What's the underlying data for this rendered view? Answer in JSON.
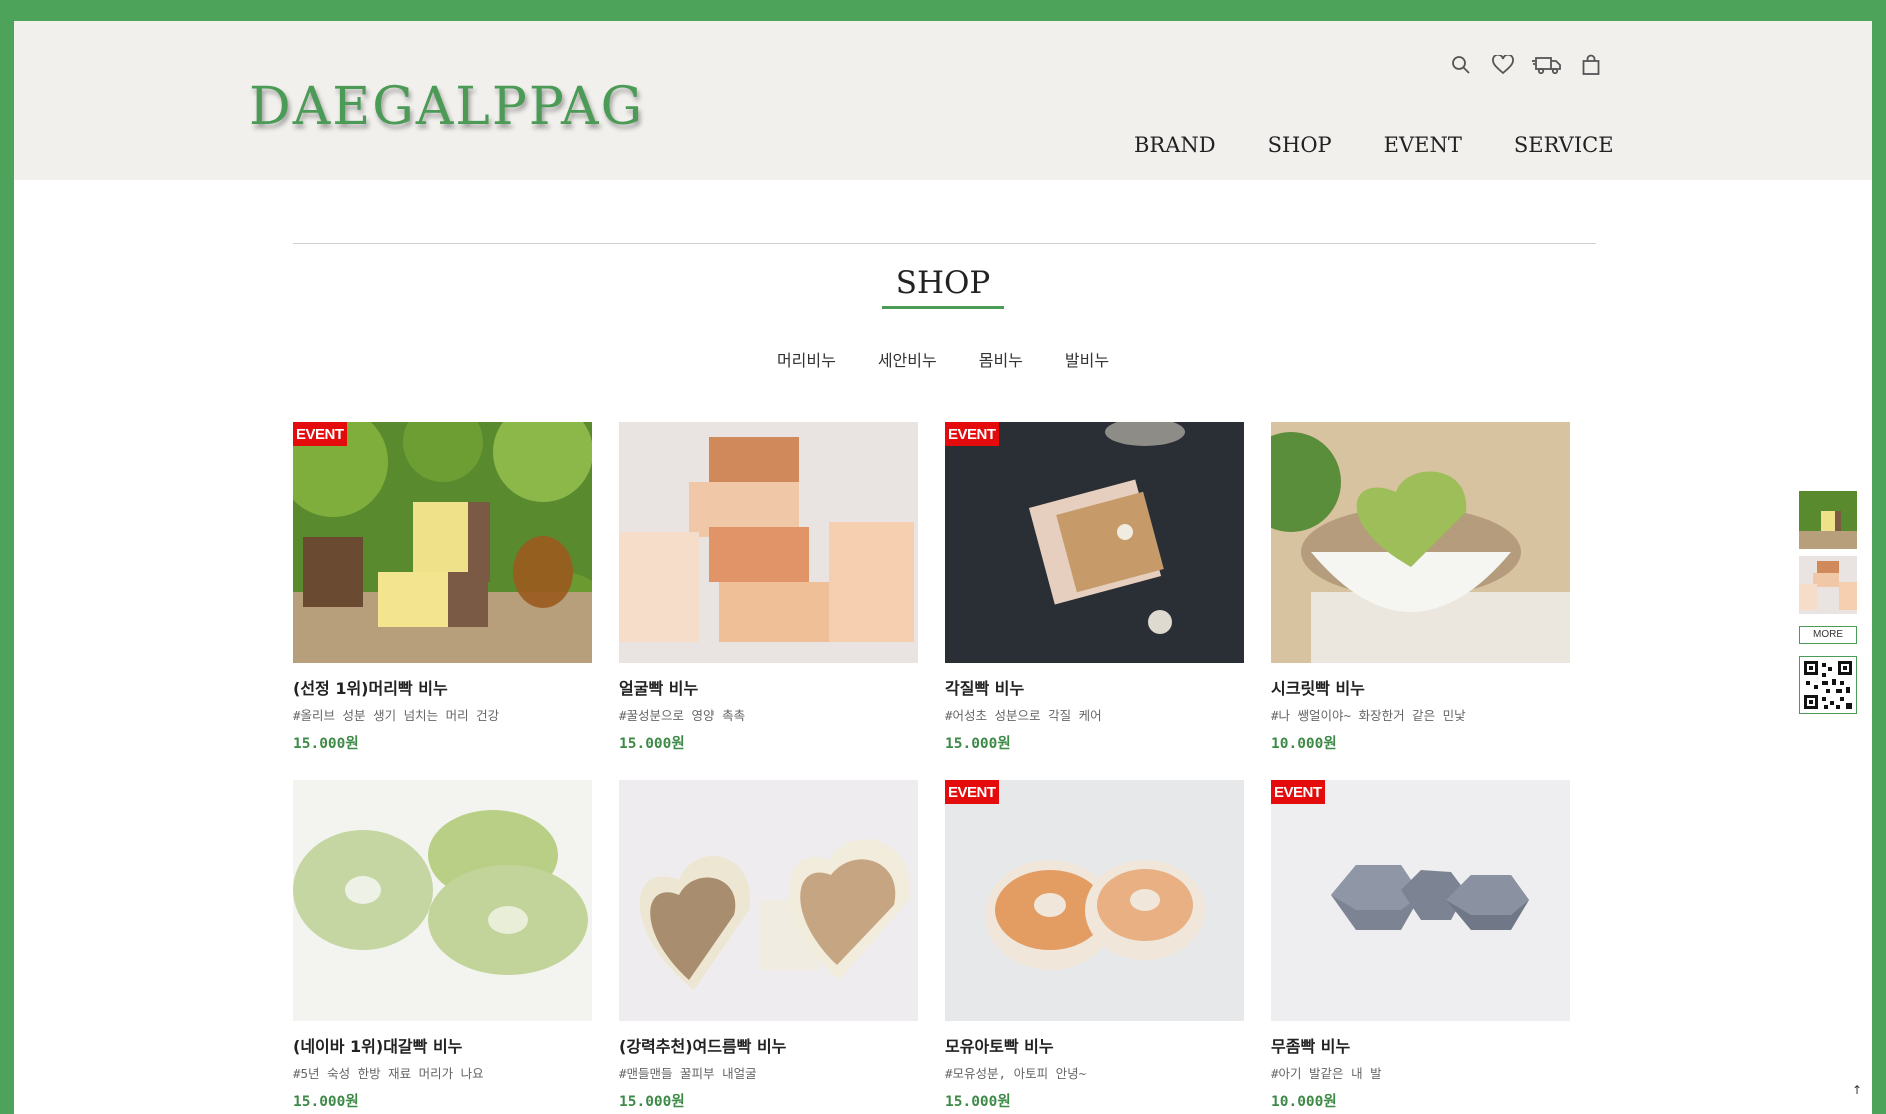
{
  "brand": {
    "logo": "DAEGALPPAG",
    "accent": "#4b9a55",
    "badge_color": "#e30b0b"
  },
  "utility_icons": [
    "search-icon",
    "heart-icon",
    "delivery-truck-icon",
    "shopping-bag-icon"
  ],
  "nav": {
    "brand": "BRAND",
    "shop": "SHOP",
    "event": "EVENT",
    "service": "SERVICE"
  },
  "section": {
    "title": "SHOP"
  },
  "categories": [
    "머리비누",
    "세안비누",
    "몸비누",
    "발비누"
  ],
  "products": [
    {
      "name": "(선정 1위)머리빡 비누",
      "desc": "#올리브 성분 생기 넘치는 머리 건강",
      "price": "15.000원",
      "badge": "EVENT"
    },
    {
      "name": "얼굴빡 비누",
      "desc": "#꿀성분으로 영양 촉촉",
      "price": "15.000원",
      "badge": ""
    },
    {
      "name": "각질빡 비누",
      "desc": "#어성초 성분으로 각질 케어",
      "price": "15.000원",
      "badge": "EVENT"
    },
    {
      "name": "시크릿빡 비누",
      "desc": "#나 쌩얼이야~ 화장한거 같은 민낯",
      "price": "10.000원",
      "badge": ""
    },
    {
      "name": "(네이바 1위)대갈빡 비누",
      "desc": "#5년 숙성 한방 재료 머리가 나요",
      "price": "15.000원",
      "badge": ""
    },
    {
      "name": "(강력추천)여드름빡 비누",
      "desc": "#맨들맨들 꿀피부 내얼굴",
      "price": "15.000원",
      "badge": ""
    },
    {
      "name": "모유아토빡 비누",
      "desc": "#모유성분, 아토피 안녕~",
      "price": "15.000원",
      "badge": "EVENT"
    },
    {
      "name": "무좀빡 비누",
      "desc": "#아기 발같은 내 발",
      "price": "10.000원",
      "badge": "EVENT"
    }
  ],
  "quick_menu": {
    "more_label": "MORE"
  },
  "scroll_top": "↑"
}
